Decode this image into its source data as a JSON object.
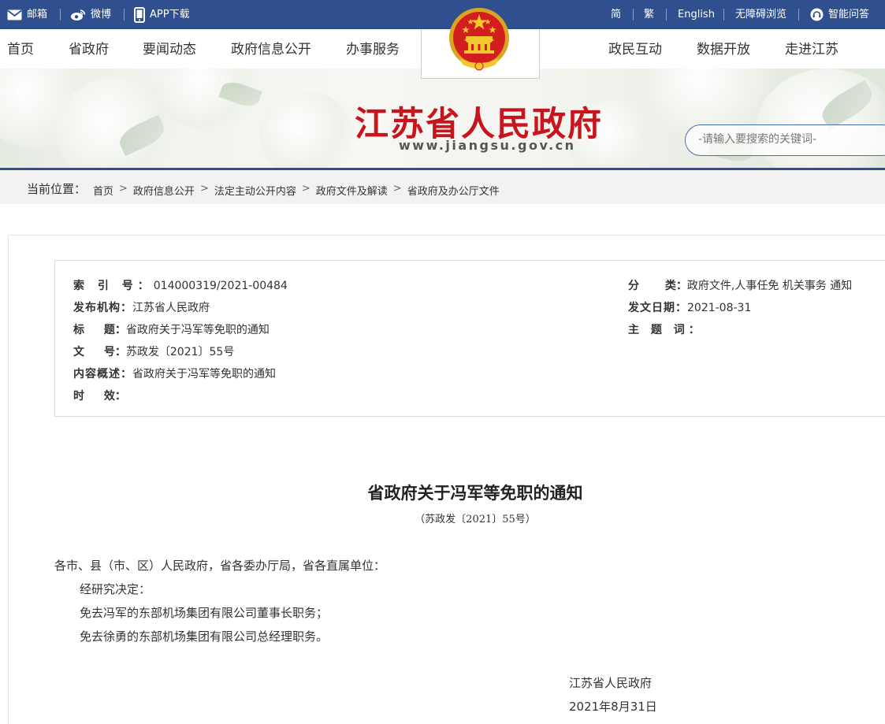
{
  "topbar": {
    "mail": "邮箱",
    "weibo": "微博",
    "app": "APP下载",
    "simplified": "简",
    "traditional": "繁",
    "english": "English",
    "accessible": "无障碍浏览",
    "qa": "智能问答"
  },
  "nav": {
    "left": [
      "首页",
      "省政府",
      "要闻动态",
      "政府信息公开",
      "办事服务"
    ],
    "right": [
      "政民互动",
      "数据开放",
      "走进江苏"
    ]
  },
  "banner": {
    "title": "江苏省人民政府",
    "url": "www.jiangsu.gov.cn",
    "search_placeholder": "-请输入要搜索的关键词-"
  },
  "breadcrumb": {
    "label": "当前位置：",
    "items": [
      "首页",
      "政府信息公开",
      "法定主动公开内容",
      "政府文件及解读",
      "省政府及办公厅文件"
    ],
    "sep": ">"
  },
  "meta": {
    "index_label": "索 引 号：",
    "index_value": "014000319/2021-00484",
    "org_label": "发布机构：",
    "org_value": "江苏省人民政府",
    "title_label": "标 题：",
    "title_value": "省政府关于冯军等免职的通知",
    "docno_label": "文 号：",
    "docno_value": "苏政发〔2021〕55号",
    "summary_label": "内容概述：",
    "summary_value": "省政府关于冯军等免职的通知",
    "validity_label": "时 效：",
    "validity_value": "",
    "category_label": "分 类：",
    "category_value": "政府文件,人事任免 机关事务 通知",
    "date_label": "发文日期：",
    "date_value": "2021-08-31",
    "topic_label": "主 题 词：",
    "topic_value": ""
  },
  "document": {
    "title": "省政府关于冯军等免职的通知",
    "number": "（苏政发〔2021〕55号）",
    "salutation": "各市、县（市、区）人民政府，省各委办厅局，省各直属单位：",
    "paragraphs": [
      "经研究决定：",
      "免去冯军的东部机场集团有限公司董事长职务；",
      "免去徐勇的东部机场集团有限公司总经理职务。"
    ],
    "signature": "江苏省人民政府",
    "date": "2021年8月31日"
  },
  "colors": {
    "topbar": "#2f4f8f",
    "title_red": "#c8151d",
    "breadcrumb_bg": "#f2f2f2"
  }
}
